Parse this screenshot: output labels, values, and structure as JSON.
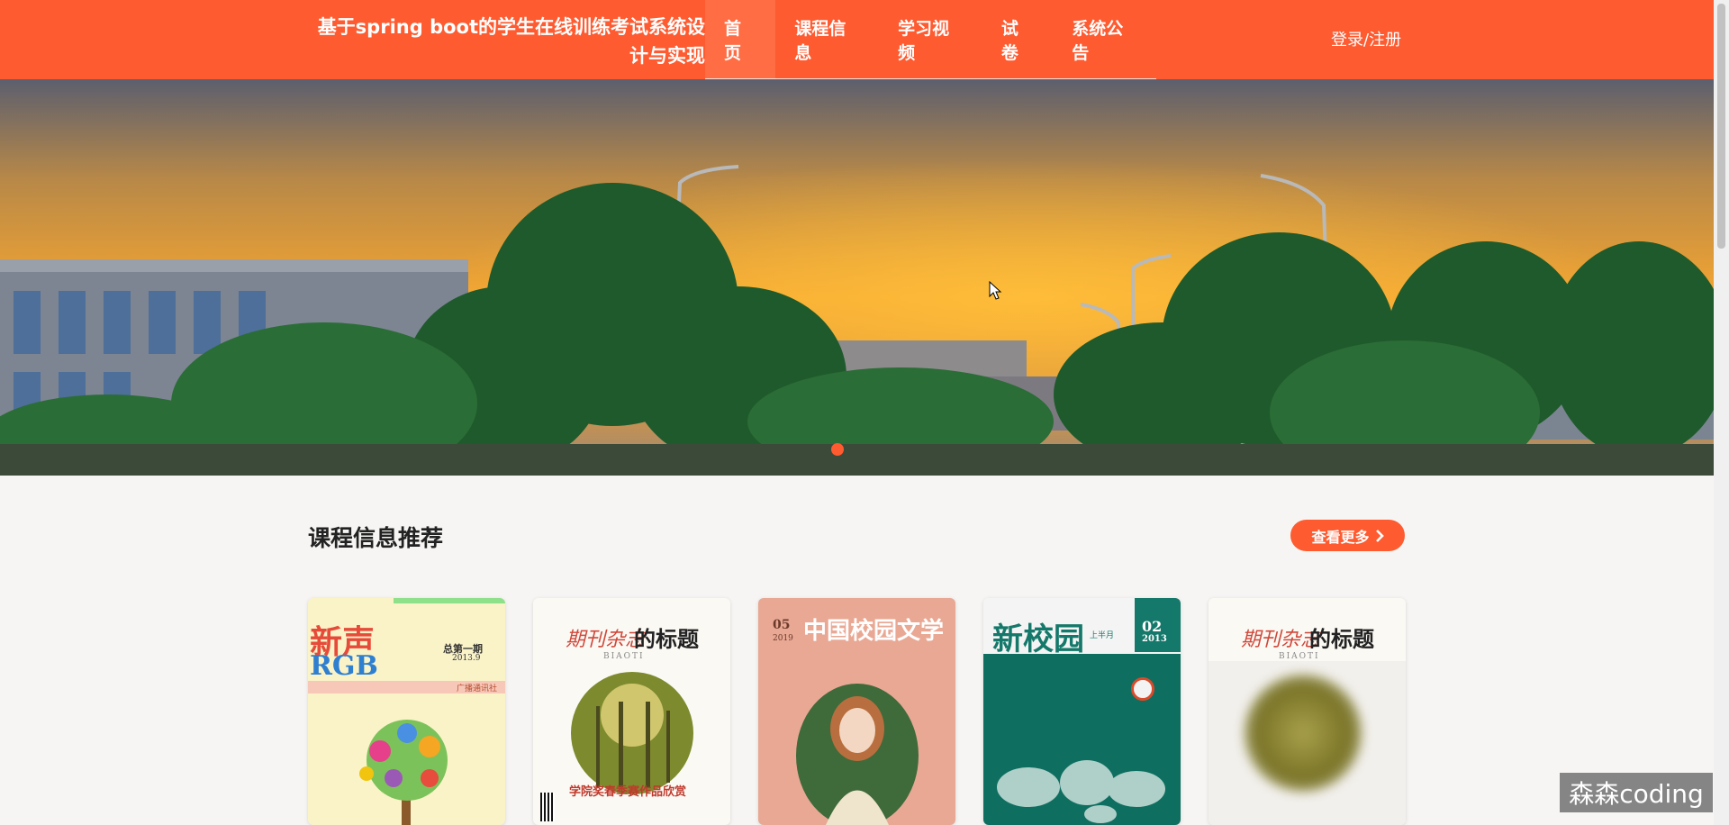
{
  "header": {
    "title_line1": "基于spring boot的学生在线训练考试系统设",
    "title_line2": "计与实现",
    "nav": [
      {
        "label": "首页",
        "active": true
      },
      {
        "label": "课程信息",
        "active": false
      },
      {
        "label": "学习视频",
        "active": false
      },
      {
        "label": "试卷",
        "active": false
      },
      {
        "label": "系统公告",
        "active": false
      }
    ],
    "login_label": "登录/注册",
    "accent_color": "#fe5b30"
  },
  "banner": {
    "slide_count": 1,
    "active_slide": 1
  },
  "section": {
    "title": "课程信息推荐",
    "more_label": "查看更多",
    "more_icon": "chevron-right-icon"
  },
  "cards": [
    {
      "cover": {
        "text1": "新声",
        "text2": "RGB",
        "text3": "总第一期",
        "text4": "2013.9",
        "text5": "广播通讯社"
      }
    },
    {
      "cover": {
        "text1": "期刊杂志",
        "text2": "的标题",
        "text3": "BIAOTI",
        "text4": "学院奖春季赛作品欣赏"
      }
    },
    {
      "cover": {
        "text1": "中国校园文学",
        "text2": "05",
        "text3": "2019"
      }
    },
    {
      "cover": {
        "text1": "新校园",
        "text2": "02",
        "text3": "2013",
        "text4": "上半月"
      }
    },
    {
      "cover": {
        "text1": "期刊杂志",
        "text2": "的标题",
        "text3": "BIAOTI"
      }
    }
  ],
  "watermark": "森森coding"
}
